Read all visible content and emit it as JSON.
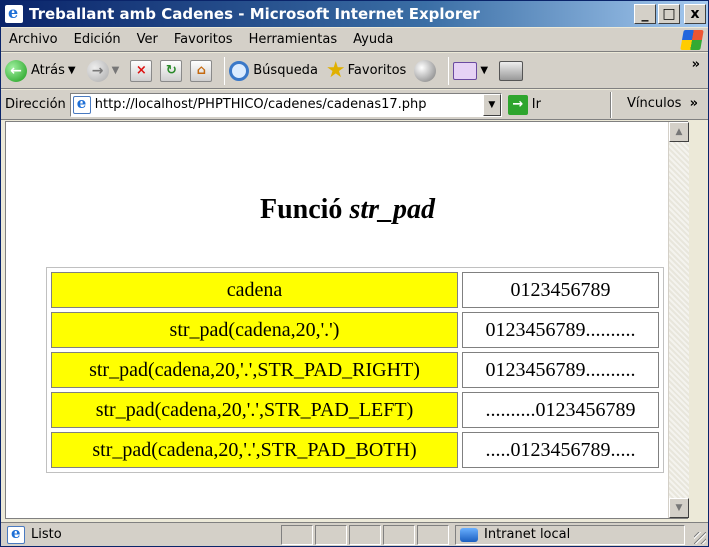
{
  "window": {
    "title": "Treballant amb Cadenes - Microsoft Internet Explorer",
    "min_label": "_",
    "max_label": "□",
    "close_label": "x"
  },
  "menu": {
    "items": [
      {
        "label": "Archivo"
      },
      {
        "label": "Edición"
      },
      {
        "label": "Ver"
      },
      {
        "label": "Favoritos"
      },
      {
        "label": "Herramientas"
      },
      {
        "label": "Ayuda"
      }
    ]
  },
  "toolbar": {
    "back_label": "Atrás",
    "search_label": "Búsqueda",
    "favorites_label": "Favoritos",
    "more": "»"
  },
  "address": {
    "label": "Dirección",
    "url": "http://localhost/PHPTHICO/cadenes/cadenas17.php",
    "go_label": "Ir",
    "links_label": "Vínculos",
    "links_more": "»"
  },
  "page": {
    "title_prefix": "Funció",
    "title_function": "str_pad",
    "rows": [
      {
        "expr": "cadena",
        "result": "0123456789"
      },
      {
        "expr": "str_pad(cadena,20,'.')",
        "result": "0123456789.........."
      },
      {
        "expr": "str_pad(cadena,20,'.',STR_PAD_RIGHT)",
        "result": "0123456789.........."
      },
      {
        "expr": "str_pad(cadena,20,'.',STR_PAD_LEFT)",
        "result": "..........0123456789"
      },
      {
        "expr": "str_pad(cadena,20,'.',STR_PAD_BOTH)",
        "result": ".....0123456789....."
      }
    ]
  },
  "status": {
    "text": "Listo",
    "zone": "Intranet local"
  },
  "colors": {
    "highlight": "#ffff00",
    "titlebar": "#0a246a"
  }
}
